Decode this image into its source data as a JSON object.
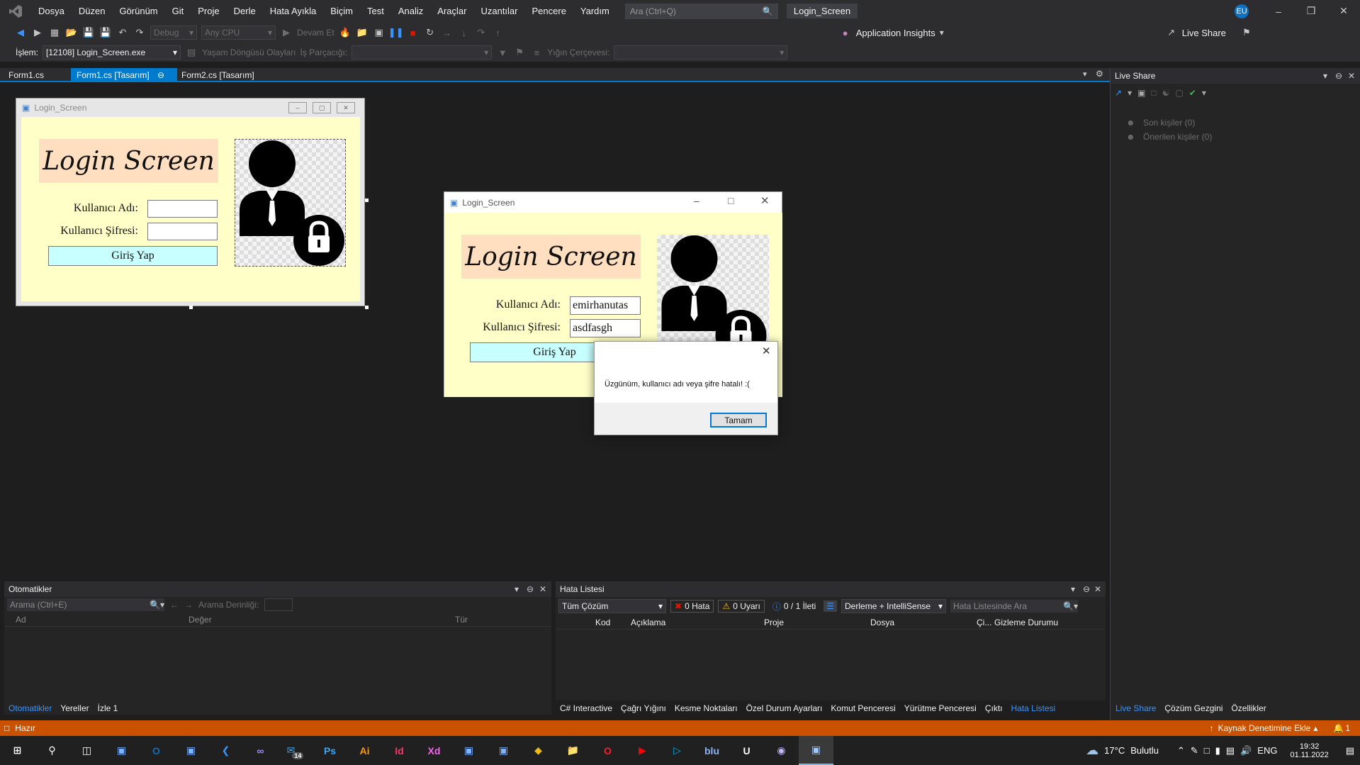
{
  "menu": {
    "items": [
      "Dosya",
      "Düzen",
      "Görünüm",
      "Git",
      "Proje",
      "Derle",
      "Hata Ayıkla",
      "Biçim",
      "Test",
      "Analiz",
      "Araçlar",
      "Uzantılar",
      "Pencere",
      "Yardım"
    ],
    "search_placeholder": "Ara (Ctrl+Q)",
    "solution_name": "Login_Screen",
    "user_initials": "EU"
  },
  "toolbar": {
    "config": "Debug",
    "platform": "Any CPU",
    "continue_label": "Devam Et",
    "app_insights": "Application Insights",
    "live_share": "Live Share"
  },
  "toolbar2": {
    "process_label": "İşlem:",
    "process_value": "[12108] Login_Screen.exe",
    "lifecycle_label": "Yaşam Döngüsü Olayları",
    "thread_label": "İş Parçacığı:",
    "stack_label": "Yığın Çerçevesi:"
  },
  "tabs": [
    {
      "label": "Form1.cs"
    },
    {
      "label": "Form1.cs [Tasarım]"
    },
    {
      "label": "Form2.cs [Tasarım]"
    }
  ],
  "designer_form": {
    "title": "Login_Screen",
    "heading": "Login Screen",
    "username_label": "Kullanıcı Adı:",
    "password_label": "Kullanıcı Şifresi:",
    "login_button": "Giriş Yap"
  },
  "running_form": {
    "title": "Login_Screen",
    "heading": "Login Screen",
    "username_label": "Kullanıcı Adı:",
    "password_label": "Kullanıcı Şifresi:",
    "username_value": "emirhanutas",
    "password_value": "asdfasgh",
    "login_button": "Giriş Yap"
  },
  "message_box": {
    "message": "Üzgünüm, kullanıcı adı veya şifre hatalı! :(",
    "ok_button": "Tamam"
  },
  "live_share_panel": {
    "title": "Live Share",
    "recent": "Son kişiler (0)",
    "suggested": "Önerilen kişiler (0)"
  },
  "autos_panel": {
    "title": "Otomatikler",
    "search_placeholder": "Arama (Ctrl+E)",
    "depth_label": "Arama Derinliği:",
    "col_name": "Ad",
    "col_value": "Değer",
    "col_type": "Tür",
    "bottom_tabs": [
      "Otomatikler",
      "Yereller",
      "İzle 1"
    ]
  },
  "error_panel": {
    "title": "Hata Listesi",
    "scope": "Tüm Çözüm",
    "errors": "0 Hata",
    "warnings": "0 Uyarı",
    "messages": "0 / 1 İleti",
    "build_filter": "Derleme + IntelliSense",
    "search_placeholder": "Hata Listesinde Ara",
    "columns": [
      "Kod",
      "Açıklama",
      "Proje",
      "Dosya",
      "Çi...",
      "Gizleme Durumu"
    ],
    "bottom_tabs": [
      "C# Interactive",
      "Çağrı Yığını",
      "Kesme Noktaları",
      "Özel Durum Ayarları",
      "Komut Penceresi",
      "Yürütme Penceresi",
      "Çıktı",
      "Hata Listesi"
    ]
  },
  "right_bottom_tabs": [
    "Live Share",
    "Çözüm Gezgini",
    "Özellikler"
  ],
  "status": {
    "ready": "Hazır",
    "source_control": "Kaynak Denetimine Ekle",
    "notifications": "1"
  },
  "taskbar": {
    "icons": [
      "start-icon",
      "search-icon",
      "taskview-icon",
      "app-icon",
      "outlook-icon",
      "app-icon",
      "vscode-icon",
      "visual-studio-icon",
      "mail-icon",
      "photoshop-icon",
      "illustrator-icon",
      "indesign-icon",
      "xd-icon",
      "app-icon",
      "app-icon",
      "binance-icon",
      "explorer-icon",
      "opera-icon",
      "youtube-icon",
      "prime-video-icon",
      "blutv-icon",
      "ubisoft-icon",
      "github-icon",
      "login-screen-app-icon"
    ],
    "mail_badge": "14",
    "weather_temp": "17°C",
    "weather_text": "Bulutlu",
    "language": "ENG",
    "time": "19:32",
    "date": "01.11.2022"
  }
}
